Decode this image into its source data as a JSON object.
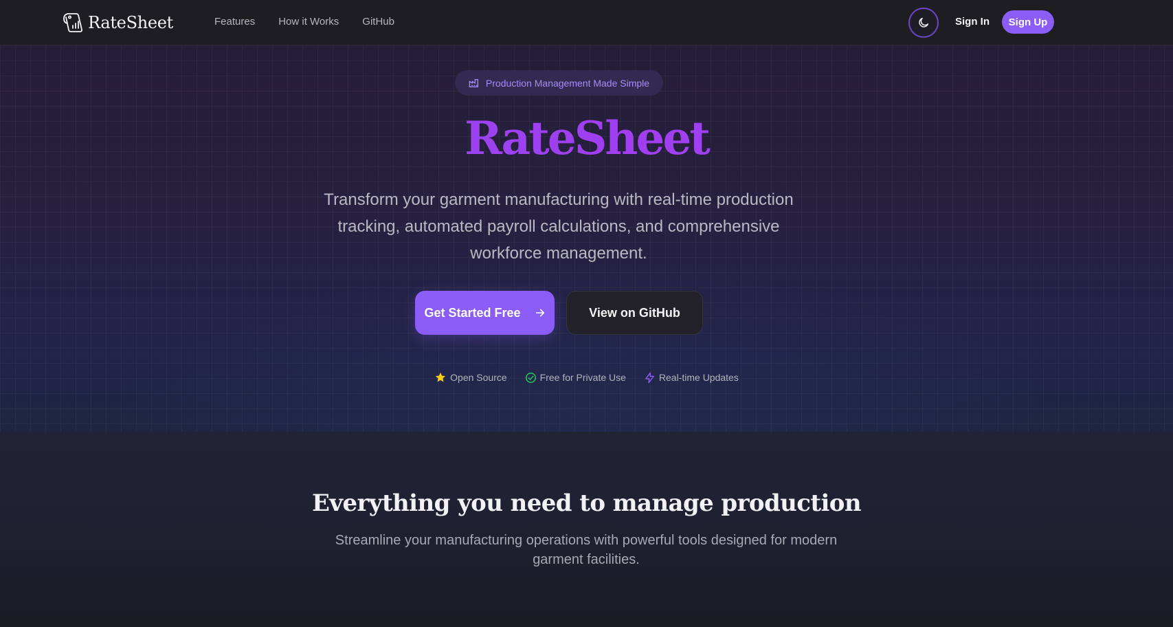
{
  "brand": {
    "name": "RateSheet",
    "logo_icon": "tag-chart-icon"
  },
  "nav": {
    "links": [
      "Features",
      "How it Works",
      "GitHub"
    ],
    "theme_toggle_icon": "moon-icon",
    "sign_in": "Sign In",
    "sign_up": "Sign Up"
  },
  "hero": {
    "pill": {
      "icon": "factory-icon",
      "text": "Production Management Made Simple"
    },
    "title": "RateSheet",
    "subtitle": "Transform your garment manufacturing with real-time production tracking, automated payroll calculations, and comprehensive workforce management.",
    "cta_primary": {
      "label": "Get Started Free",
      "icon": "arrow-right-icon"
    },
    "cta_secondary": {
      "label": "View on GitHub"
    },
    "badges": [
      {
        "icon": "star-icon",
        "label": "Open Source",
        "color": "#facc15"
      },
      {
        "icon": "check-circle-icon",
        "label": "Free for Private Use",
        "color": "#22c55e"
      },
      {
        "icon": "lightning-icon",
        "label": "Real-time Updates",
        "color": "#8b5cf6"
      }
    ]
  },
  "features": {
    "title": "Everything you need to manage production",
    "subtitle": "Streamline your manufacturing operations with powerful tools designed for modern garment facilities."
  },
  "colors": {
    "accent": "#8b5cf6",
    "background": "#1c1c22",
    "hero_background": "#261f3c"
  }
}
